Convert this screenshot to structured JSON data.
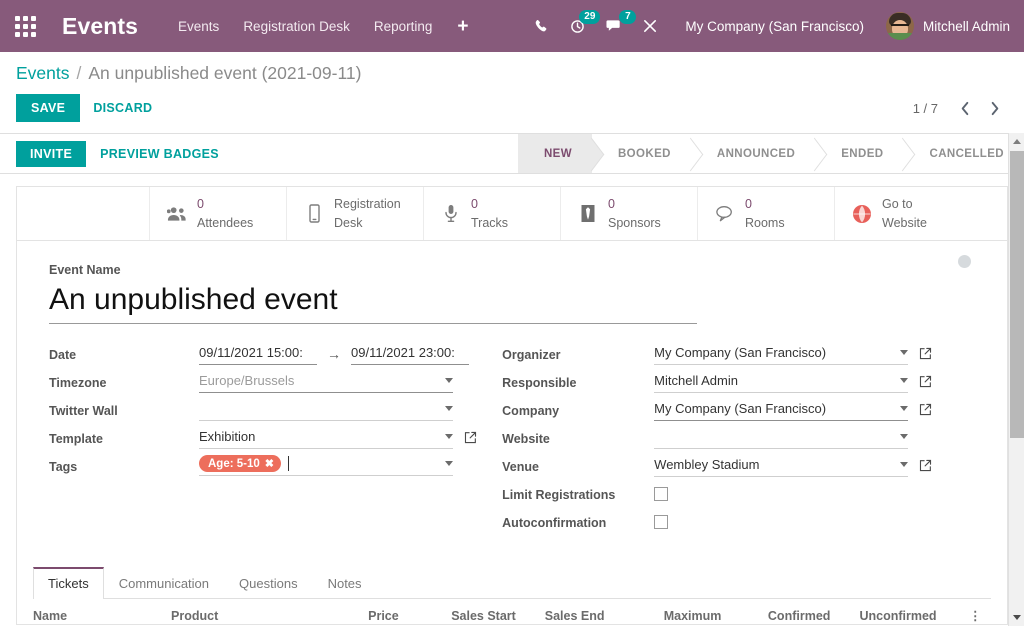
{
  "navbar": {
    "apps_icon": "apps-grid-icon",
    "brand": "Events",
    "menu": [
      {
        "label": "Events"
      },
      {
        "label": "Registration Desk"
      },
      {
        "label": "Reporting"
      }
    ],
    "plus_label": "+",
    "sys_icons": [
      {
        "name": "phone-icon",
        "badge": ""
      },
      {
        "name": "activity-clock-icon",
        "badge": "29"
      },
      {
        "name": "messages-icon",
        "badge": "7"
      },
      {
        "name": "developer-tools-icon",
        "badge": ""
      }
    ],
    "company": "My Company (San Francisco)",
    "user": "Mitchell Admin",
    "accent_color": "#875A7B"
  },
  "breadcrumb": {
    "root": "Events",
    "separator": "/",
    "current": "An unpublished event (2021-09-11)"
  },
  "actions": {
    "save": "SAVE",
    "discard": "DISCARD"
  },
  "pager": {
    "count": "1 / 7",
    "prev_icon": "chevron-left-icon",
    "next_icon": "chevron-right-icon"
  },
  "statusbar": {
    "invite": "INVITE",
    "preview_badges": "PREVIEW BADGES",
    "stages": [
      {
        "label": "NEW",
        "active": true
      },
      {
        "label": "BOOKED",
        "active": false
      },
      {
        "label": "ANNOUNCED",
        "active": false
      },
      {
        "label": "ENDED",
        "active": false
      },
      {
        "label": "CANCELLED",
        "active": false
      }
    ],
    "active_color": "#7c4b6e"
  },
  "stat_buttons": [
    {
      "icon": "users-icon",
      "value": "0",
      "label": "Attendees"
    },
    {
      "icon": "mobile-icon",
      "value": "Registration",
      "label": "Desk"
    },
    {
      "icon": "microphone-icon",
      "value": "0",
      "label": "Tracks"
    },
    {
      "icon": "tie-icon",
      "value": "0",
      "label": "Sponsors"
    },
    {
      "icon": "comment-icon",
      "value": "0",
      "label": "Rooms"
    },
    {
      "icon": "globe-icon",
      "value": "Go to",
      "label": "Website"
    }
  ],
  "form": {
    "event_name_label": "Event Name",
    "event_name_value": "An unpublished event",
    "published_dot": "unpublished-indicator",
    "left": {
      "date_label": "Date",
      "date_start": "09/11/2021 15:00:",
      "date_arrow": "→",
      "date_end": "09/11/2021 23:00:",
      "timezone_label": "Timezone",
      "timezone_value": "Europe/Brussels",
      "twitter_wall_label": "Twitter Wall",
      "twitter_wall_value": "",
      "template_label": "Template",
      "template_value": "Exhibition",
      "tags_label": "Tags",
      "tag": "Age: 5-10",
      "tag_remove": "✖",
      "tag_color": "#ED6E5C"
    },
    "right": {
      "organizer_label": "Organizer",
      "organizer_value": "My Company (San Francisco)",
      "responsible_label": "Responsible",
      "responsible_value": "Mitchell Admin",
      "company_label": "Company",
      "company_value": "My Company (San Francisco)",
      "website_label": "Website",
      "website_value": "",
      "venue_label": "Venue",
      "venue_value": "Wembley Stadium",
      "limit_registrations_label": "Limit Registrations",
      "limit_registrations_checked": false,
      "autoconfirmation_label": "Autoconfirmation",
      "autoconfirmation_checked": false
    }
  },
  "notebook": {
    "tabs": [
      {
        "label": "Tickets",
        "active": true
      },
      {
        "label": "Communication",
        "active": false
      },
      {
        "label": "Questions",
        "active": false
      },
      {
        "label": "Notes",
        "active": false
      }
    ],
    "columns": [
      "Name",
      "Product",
      "Price",
      "Sales Start",
      "Sales End",
      "Maximum",
      "Confirmed",
      "Unconfirmed"
    ],
    "options_icon": "column-options-icon",
    "rows": []
  },
  "scrollbar": {
    "up_icon": "scroll-up-icon",
    "down_icon": "scroll-down-icon"
  }
}
